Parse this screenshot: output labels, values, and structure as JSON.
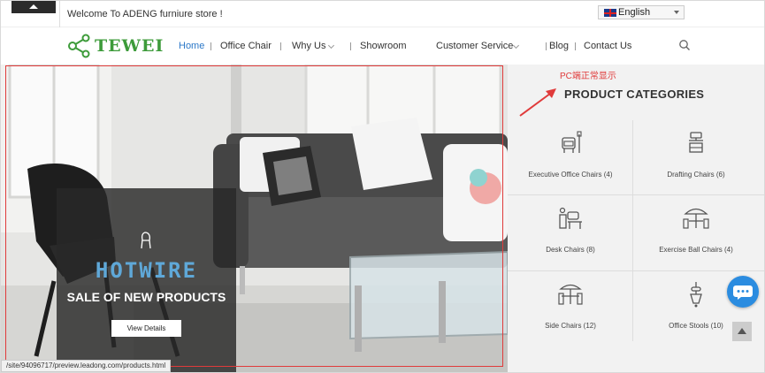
{
  "topbar": {
    "welcome_text": "Welcome To ADENG furniure store !",
    "language": "English"
  },
  "brand": {
    "name": "TEWEI",
    "color": "#3d9b3a"
  },
  "nav": {
    "items": [
      {
        "label": "Home",
        "active": true
      },
      {
        "label": "Office Chair"
      },
      {
        "label": "Why Us",
        "dropdown": true
      },
      {
        "label": "Showroom"
      },
      {
        "label": "Customer Service",
        "dropdown": true
      },
      {
        "label": "Blog"
      },
      {
        "label": "Contact Us"
      }
    ],
    "active_color": "#2c78c8"
  },
  "hero": {
    "promo_title": "HOTWIRE",
    "promo_subtitle": "SALE OF NEW PRODUCTS",
    "button_label": "View Details",
    "status_url": "/site/94096717/preview.leadong.com/products.html"
  },
  "annotation": {
    "text": "PC端正常显示",
    "color": "#e03b3b"
  },
  "categories": {
    "title": "PRODUCT CATEGORIES",
    "items": [
      {
        "label": "Executive Office Chairs (4)",
        "icon": "executive-chair-icon"
      },
      {
        "label": "Drafting Chairs (6)",
        "icon": "drafting-chair-icon"
      },
      {
        "label": "Desk Chairs (8)",
        "icon": "desk-chair-icon"
      },
      {
        "label": "Exercise Ball Chairs (4)",
        "icon": "umbrella-table-icon"
      },
      {
        "label": "Side Chairs (12)",
        "icon": "patio-table-icon"
      },
      {
        "label": "Office Stools (10)",
        "icon": "stool-icon"
      }
    ]
  }
}
